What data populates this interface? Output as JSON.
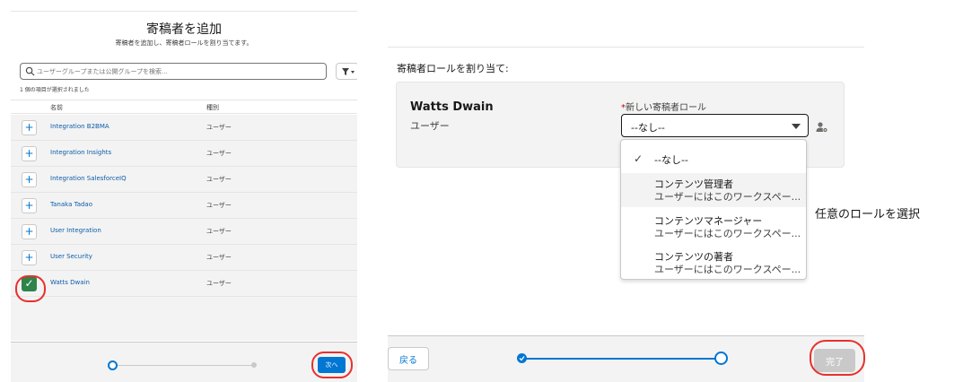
{
  "left_panel": {
    "title": "寄稿者を追加",
    "subtitle": "寄稿者を追加し、寄稿者ロールを割り当てます。",
    "search": {
      "placeholder": "ユーザーグループまたは公開グループを検索..."
    },
    "selected_count": "1 個の項目が選択されました",
    "columns": {
      "name": "名前",
      "type": "種別"
    },
    "rows": [
      {
        "name": "Integration B2BMA",
        "type": "ユーザー",
        "selected": false
      },
      {
        "name": "Integration Insights",
        "type": "ユーザー",
        "selected": false
      },
      {
        "name": "Integration SalesforceIQ",
        "type": "ユーザー",
        "selected": false
      },
      {
        "name": "Tanaka Tadao",
        "type": "ユーザー",
        "selected": false
      },
      {
        "name": "User Integration",
        "type": "ユーザー",
        "selected": false
      },
      {
        "name": "User Security",
        "type": "ユーザー",
        "selected": false
      },
      {
        "name": "Watts Dwain",
        "type": "ユーザー",
        "selected": true
      }
    ],
    "add_symbol": "+",
    "check_symbol": "✓",
    "next_label": "次へ"
  },
  "right_panel": {
    "assign_label": "寄稿者ロールを割り当て:",
    "user": {
      "name": "Watts Dwain",
      "type": "ユーザー"
    },
    "role_field": {
      "required_mark": "*",
      "label": "新しい寄稿者ロール",
      "value": "--なし--"
    },
    "options": [
      {
        "label": "--なし--",
        "desc": "",
        "checked": true
      },
      {
        "label": "コンテンツ管理者",
        "desc": "ユーザーにはこのワークスペー...",
        "checked": false
      },
      {
        "label": "コンテンツマネージャー",
        "desc": "ユーザーにはこのワークスペー...",
        "checked": false
      },
      {
        "label": "コンテンツの著者",
        "desc": "ユーザーにはこのワークスペー...",
        "checked": false
      }
    ],
    "back_label": "戻る",
    "done_label": "完了"
  },
  "annotation": "任意のロールを選択",
  "colors": {
    "brand": "#0176d3",
    "link": "#0b5cab",
    "success": "#2e844a",
    "highlight": "#e8302c",
    "disabled": "#c9c9c9"
  }
}
